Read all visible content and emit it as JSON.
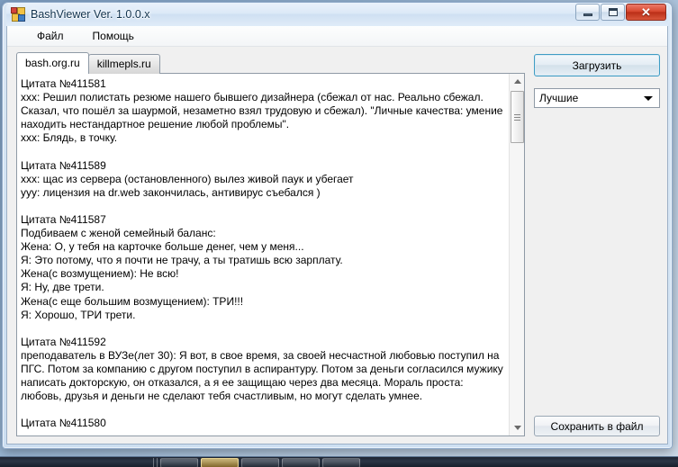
{
  "window": {
    "title": "BashViewer Ver. 1.0.0.x",
    "icon": "app-grid-icon",
    "controls": {
      "minimize": "minimize-icon",
      "maximize": "maximize-icon",
      "close": "✕"
    }
  },
  "menu": {
    "items": [
      {
        "label": "Файл"
      },
      {
        "label": "Помощь"
      }
    ]
  },
  "tabs": [
    {
      "label": "bash.org.ru",
      "active": true
    },
    {
      "label": "killmepls.ru",
      "active": false
    }
  ],
  "quotes_text": "Цитата №411581\nxxx: Решил полистать резюме нашего бывшего дизайнера (сбежал от нас. Реально сбежал.\nСказал, что пошёл за шаурмой, незаметно взял трудовую и сбежал). \"Личные качества: умение\nнаходить нестандартное решение любой проблемы\".\nxxx: Блядь, в точку.\n\nЦитата №411589\nxxx: щас из сервера (остановленного) вылез живой паук и убегает\nyyy: лицензия на dr.web закончилась, антивирус съебался )\n\nЦитата №411587\nПодбиваем с женой семейный баланс:\nЖена: О, у тебя на карточке больше денег, чем у меня...\nЯ: Это потому, что я почти не трачу, а ты тратишь всю зарплату.\nЖена(с возмущением): Не всю!\nЯ: Ну, две трети.\nЖена(с еще большим возмущением): ТРИ!!!\nЯ: Хорошо, ТРИ трети.\n\nЦитата №411592\nпреподаватель в ВУЗе(лет 30): Я вот, в свое время, за своей несчастной любовью поступил на\nПГС. Потом за компанию с другом поступил в аспирантуру. Потом за деньги согласился мужику\nнаписать докторскую, он отказался, а я ее защищаю через два месяца. Мораль проста:\nлюбовь, друзья и деньги не сделают тебя счастливым, но могут сделать умнее.\n\nЦитата №411580",
  "scrollbar": {
    "up_icon": "scroll-up-arrow-icon",
    "down_icon": "scroll-down-arrow-icon"
  },
  "sidebar": {
    "load_button": "Загрузить",
    "sort_select": {
      "value": "Лучшие",
      "arrow_icon": "chevron-down-icon"
    },
    "save_button": "Сохранить в файл"
  },
  "colors": {
    "focus_border": "#3f9cc4",
    "close_button": "#d8492f",
    "title_text": "#11334e",
    "text_area_bg": "#ffffff"
  }
}
